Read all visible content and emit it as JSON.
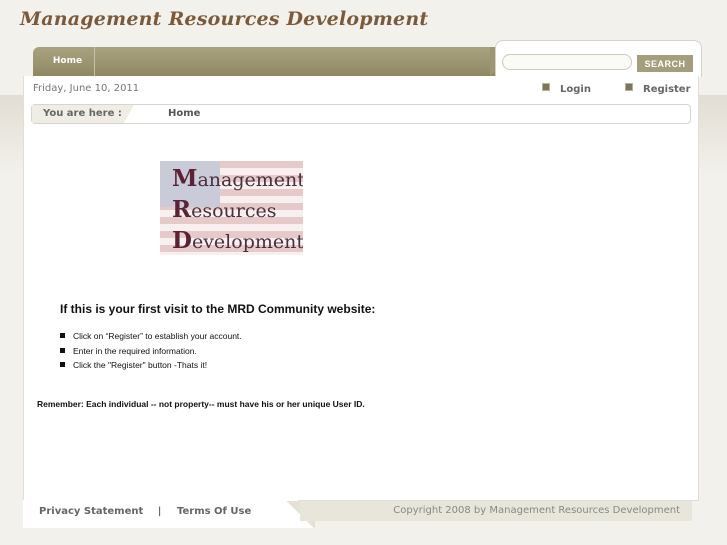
{
  "header": {
    "site_title": "Management Resources Development"
  },
  "nav": {
    "home_label": "Home"
  },
  "search": {
    "placeholder": "",
    "button_label": "SEARCH"
  },
  "topbar": {
    "date": "Friday, June 10, 2011",
    "login_label": "Login",
    "register_label": "Register"
  },
  "breadcrumb": {
    "label": "You are here :",
    "current": "Home"
  },
  "logo": {
    "lines": [
      {
        "cap": "M",
        "rest": "anagement"
      },
      {
        "cap": "R",
        "rest": "esources"
      },
      {
        "cap": "D",
        "rest": "evelopment"
      }
    ]
  },
  "content": {
    "heading": "If this is your first visit to the MRD Community website:",
    "steps": [
      "Click on “Register” to establish your account.",
      "Enter in the required information.",
      "Click the \"Register\" button -Thats it!"
    ],
    "remember": "Remember:  Each individual -- not property-- must have his or her unique User ID."
  },
  "footer": {
    "privacy_label": "Privacy Statement",
    "separator": "|",
    "terms_label": "Terms Of Use",
    "copyright": "Copyright 2008 by Management Resources Development"
  },
  "colors": {
    "nav_bar": "#9c9672",
    "title_brown": "#7a5a3a",
    "panel_bg": "#ffffff"
  }
}
